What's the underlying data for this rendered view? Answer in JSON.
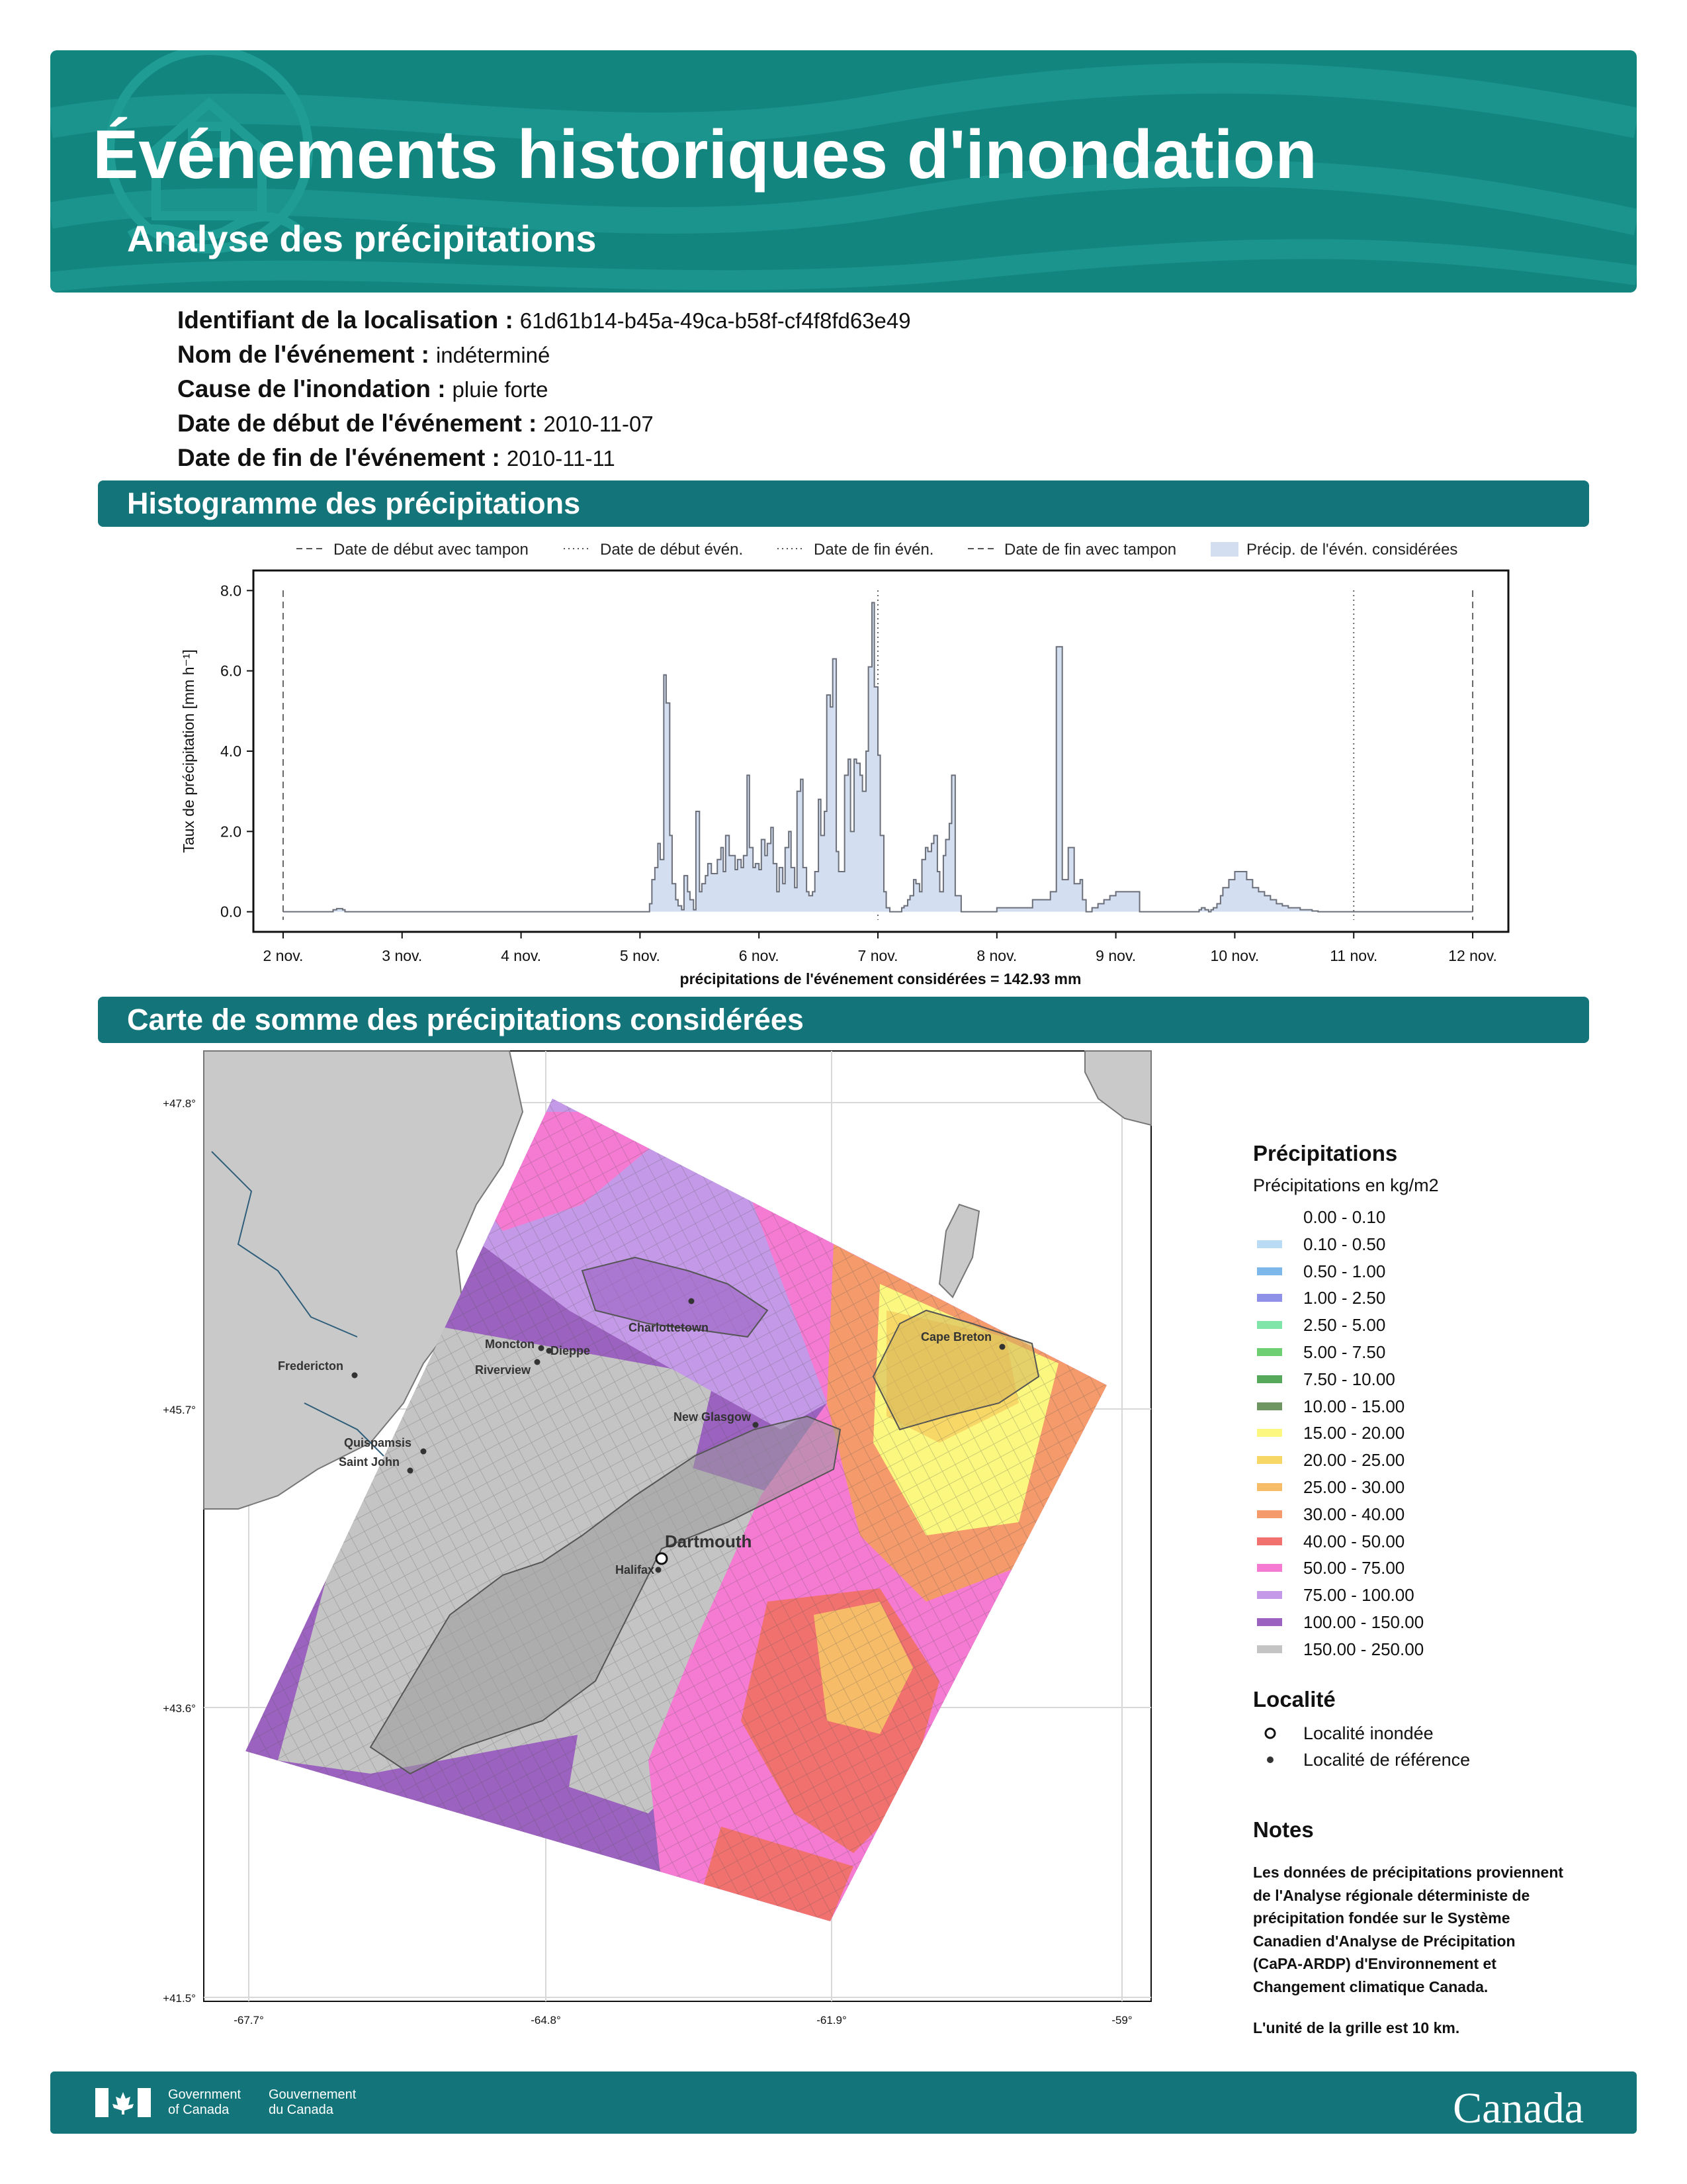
{
  "header": {
    "title": "Événements historiques d'inondation",
    "subtitle": "Analyse des précipitations"
  },
  "info": [
    {
      "label": "Identifiant de la localisation :",
      "value": "61d61b14-b45a-49ca-b58f-cf4f8fd63e49"
    },
    {
      "label": "Nom de l'événement :",
      "value": "indéterminé"
    },
    {
      "label": "Cause de l'inondation :",
      "value": "pluie forte"
    },
    {
      "label": "Date de début de l'événement :",
      "value": "2010-11-07"
    },
    {
      "label": "Date de fin de l'événement :",
      "value": "2010-11-11"
    }
  ],
  "sections": {
    "histogram": "Histogramme des précipitations",
    "map": "Carte de somme des précipitations considérées"
  },
  "chart_data": {
    "type": "area",
    "ylabel": "Taux de précipitation [mm h⁻¹]",
    "xlabel": "précipitations de l'événement considérées = 142.93 mm",
    "ylim": [
      -0.5,
      8.5
    ],
    "xlim": [
      -0.25,
      10.3
    ],
    "yticks": [
      0.0,
      2.0,
      4.0,
      6.0,
      8.0
    ],
    "ytick_labels": [
      "0.0",
      "2.0",
      "4.0",
      "6.0",
      "8.0"
    ],
    "xticks": [
      0,
      1,
      2,
      3,
      4,
      5,
      6,
      7,
      8,
      9,
      10
    ],
    "xtick_labels": [
      "2 nov.",
      "3 nov.",
      "4 nov.",
      "5 nov.",
      "6 nov.",
      "7 nov.",
      "8 nov.",
      "9 nov.",
      "10 nov.",
      "11 nov.",
      "12 nov."
    ],
    "x_unit": "jours depuis le 2 nov.",
    "legend_placement": "top",
    "legend": [
      {
        "label": "Date de début avec tampon",
        "style": "dashed"
      },
      {
        "label": "Date de début évén.",
        "style": "dotted"
      },
      {
        "label": "Date de fin évén.",
        "style": "dotted"
      },
      {
        "label": "Date de fin avec tampon",
        "style": "dashed"
      },
      {
        "label": "Précip. de l'évén. considérées",
        "style": "fill"
      }
    ],
    "vlines": [
      {
        "x": 0.0,
        "style": "dashed"
      },
      {
        "x": 5.0,
        "style": "dotted"
      },
      {
        "x": 9.0,
        "style": "dotted"
      },
      {
        "x": 10.0,
        "style": "dashed"
      }
    ],
    "series_x": [
      0,
      0.4,
      0.42,
      0.45,
      0.5,
      0.52,
      3,
      3.08,
      3.1,
      3.125,
      3.15,
      3.17,
      3.2,
      3.22,
      3.25,
      3.27,
      3.3,
      3.32,
      3.35,
      3.37,
      3.4,
      3.42,
      3.45,
      3.47,
      3.5,
      3.52,
      3.55,
      3.57,
      3.6,
      3.65,
      3.68,
      3.7,
      3.72,
      3.75,
      3.8,
      3.82,
      3.85,
      3.87,
      3.9,
      3.92,
      3.95,
      3.97,
      4.0,
      4.02,
      4.05,
      4.07,
      4.1,
      4.12,
      4.15,
      4.17,
      4.2,
      4.22,
      4.25,
      4.27,
      4.3,
      4.32,
      4.35,
      4.37,
      4.4,
      4.42,
      4.45,
      4.47,
      4.5,
      4.52,
      4.55,
      4.57,
      4.6,
      4.62,
      4.65,
      4.67,
      4.7,
      4.72,
      4.75,
      4.77,
      4.8,
      4.82,
      4.85,
      4.87,
      4.9,
      4.92,
      4.95,
      4.97,
      5.0,
      5.02,
      5.05,
      5.07,
      5.1,
      5.12,
      5.15,
      5.17,
      5.2,
      5.22,
      5.25,
      5.27,
      5.3,
      5.32,
      5.35,
      5.37,
      5.4,
      5.42,
      5.45,
      5.47,
      5.5,
      5.52,
      5.55,
      5.57,
      5.6,
      5.62,
      5.65,
      5.7,
      6.0,
      6.3,
      6.45,
      6.5,
      6.55,
      6.6,
      6.65,
      6.7,
      6.72,
      6.75,
      6.8,
      6.85,
      6.9,
      6.95,
      7.0,
      7.2,
      7.6,
      7.65,
      7.7,
      7.72,
      7.75,
      7.78,
      7.8,
      7.82,
      7.85,
      7.88,
      7.9,
      7.95,
      8.0,
      8.1,
      8.15,
      8.2,
      8.25,
      8.3,
      8.35,
      8.4,
      8.45,
      8.5,
      8.55,
      8.6,
      8.65,
      8.7,
      8.75,
      8.8,
      10.0
    ],
    "series_y": [
      0,
      0,
      0.05,
      0.08,
      0.05,
      0,
      0,
      0.2,
      0.8,
      1.1,
      1.7,
      1.3,
      5.9,
      5.2,
      1.9,
      0.7,
      0.3,
      0.15,
      0.05,
      0.9,
      0.5,
      0.3,
      0.05,
      2.5,
      0.5,
      0.7,
      0.9,
      1.2,
      0.95,
      1.3,
      1.6,
      1.0,
      1.9,
      1.4,
      1.05,
      1.3,
      1.1,
      1.4,
      3.4,
      1.6,
      1.1,
      1.2,
      1.05,
      1.8,
      1.4,
      1.7,
      2.1,
      1.2,
      0.5,
      1.1,
      0.7,
      1.6,
      2.0,
      1.1,
      0.6,
      3.0,
      3.3,
      1.1,
      0.5,
      0.4,
      0.5,
      1.0,
      2.8,
      1.9,
      2.5,
      5.4,
      5.1,
      6.3,
      1.5,
      1.0,
      1.0,
      3.4,
      3.8,
      2.0,
      3.8,
      3.7,
      3.4,
      3.0,
      4.0,
      6.1,
      7.7,
      5.6,
      3.9,
      1.9,
      0.5,
      0.1,
      0,
      0,
      0,
      0,
      0.1,
      0.15,
      0.3,
      0.4,
      0.8,
      0.7,
      0.5,
      1.3,
      1.6,
      1.5,
      1.7,
      1.9,
      1.0,
      0.5,
      1.4,
      1.8,
      2.2,
      3.4,
      0.4,
      0,
      0.1,
      0.3,
      0.5,
      6.6,
      0.8,
      1.6,
      0.7,
      0.8,
      0.3,
      0,
      0.1,
      0.2,
      0.3,
      0.4,
      0.5,
      0,
      0,
      0,
      0.05,
      0.1,
      0.05,
      0,
      0.05,
      0.1,
      0.2,
      0.4,
      0.6,
      0.8,
      1.0,
      0.8,
      0.6,
      0.5,
      0.4,
      0.3,
      0.2,
      0.15,
      0.1,
      0.1,
      0.05,
      0.05,
      0.02,
      0.0,
      0.0,
      0,
      0
    ]
  },
  "map": {
    "y_ticks": [
      "+47.8°",
      "+45.7°",
      "+43.6°",
      "+41.5°"
    ],
    "x_ticks": [
      "-67.7°",
      "-64.8°",
      "-61.9°",
      "-59°"
    ],
    "places": [
      {
        "name": "Charlottetown",
        "type": "reference"
      },
      {
        "name": "Moncton",
        "type": "reference"
      },
      {
        "name": "Dieppe",
        "type": "reference"
      },
      {
        "name": "Riverview",
        "type": "reference"
      },
      {
        "name": "Fredericton",
        "type": "reference"
      },
      {
        "name": "Cape Breton",
        "type": "reference"
      },
      {
        "name": "New Glasgow",
        "type": "reference"
      },
      {
        "name": "Quispamsis",
        "type": "reference"
      },
      {
        "name": "Saint John",
        "type": "reference"
      },
      {
        "name": "Dartmouth",
        "type": "flooded"
      },
      {
        "name": "Halifax",
        "type": "reference"
      }
    ]
  },
  "legend": {
    "title": "Précipitations",
    "subtitle": "Précipitations en kg/m2",
    "classes": [
      {
        "label": "0.00 - 0.10",
        "color": "#ffffff"
      },
      {
        "label": "0.10 - 0.50",
        "color": "#b9dbf3"
      },
      {
        "label": "0.50 - 1.00",
        "color": "#7cb8ea"
      },
      {
        "label": "1.00 - 2.50",
        "color": "#8f91e8"
      },
      {
        "label": "2.50 - 5.00",
        "color": "#7fe5a8"
      },
      {
        "label": "5.00 - 7.50",
        "color": "#6dcf72"
      },
      {
        "label": "7.50 - 10.00",
        "color": "#56a85a"
      },
      {
        "label": "10.00 - 15.00",
        "color": "#6f9563"
      },
      {
        "label": "15.00 - 20.00",
        "color": "#fbf77f"
      },
      {
        "label": "20.00 - 25.00",
        "color": "#f7d766"
      },
      {
        "label": "25.00 - 30.00",
        "color": "#f7bc68"
      },
      {
        "label": "30.00 - 40.00",
        "color": "#f49a6b"
      },
      {
        "label": "40.00 - 50.00",
        "color": "#f0716e"
      },
      {
        "label": "50.00 - 75.00",
        "color": "#f57ad2"
      },
      {
        "label": "75.00 - 100.00",
        "color": "#c49ae8"
      },
      {
        "label": "100.00 - 150.00",
        "color": "#9b62bf"
      },
      {
        "label": "150.00 - 250.00",
        "color": "#c4c4c4"
      }
    ],
    "locality_title": "Localité",
    "locality_flooded": "Localité inondée",
    "locality_reference": "Localité de référence"
  },
  "notes": {
    "title": "Notes",
    "lines": [
      "Les données de précipitations proviennent",
      "de l'Analyse régionale déterministe de",
      "précipitation fondée sur le Système",
      "Canadien d'Analyse de Précipitation",
      "(CaPA-ARDP) d'Environnement et",
      "Changement climatique Canada."
    ],
    "grid_unit": "L'unité de la grille est 10 km."
  },
  "footer": {
    "gov_en_1": "Government",
    "gov_en_2": "of Canada",
    "gov_fr_1": "Gouvernement",
    "gov_fr_2": "du Canada",
    "wordmark": "Canada"
  }
}
